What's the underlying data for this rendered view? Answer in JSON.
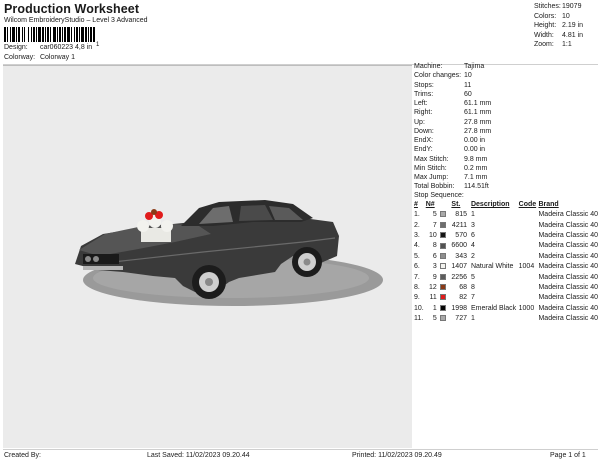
{
  "header": {
    "title": "Production Worksheet",
    "subtitle": "Wilcom EmbroideryStudio – Level 3 Advanced",
    "barcode_text": "1",
    "design_label": "Design:",
    "design_value": "car060223 4,8 in",
    "colorway_label": "Colorway:",
    "colorway_value": "Colorway 1"
  },
  "stats": [
    {
      "label": "Stitches:",
      "value": "19079"
    },
    {
      "label": "Colors:",
      "value": "10"
    },
    {
      "label": "Height:",
      "value": "2.19 in"
    },
    {
      "label": "Width:",
      "value": "4.81 in"
    },
    {
      "label": "Zoom:",
      "value": "1:1"
    }
  ],
  "parameters": [
    {
      "label": "Machine:",
      "value": "Tajima"
    },
    {
      "label": "Color changes:",
      "value": "10"
    },
    {
      "label": "Stops:",
      "value": "11"
    },
    {
      "label": "Trims:",
      "value": "60"
    },
    {
      "label": "Left:",
      "value": "61.1 mm"
    },
    {
      "label": "Right:",
      "value": "61.1 mm"
    },
    {
      "label": "Up:",
      "value": "27.8 mm"
    },
    {
      "label": "Down:",
      "value": "27.8 mm"
    },
    {
      "label": "EndX:",
      "value": "0.00 in"
    },
    {
      "label": "EndY:",
      "value": "0.00 in"
    },
    {
      "label": "Max Stitch:",
      "value": "9.8 mm"
    },
    {
      "label": "Min Stitch:",
      "value": "0.2 mm"
    },
    {
      "label": "Max Jump:",
      "value": "7.1 mm"
    },
    {
      "label": "Total Bobbin:",
      "value": "114.51ft"
    }
  ],
  "stop_sequence": {
    "title": "Stop Sequence:",
    "columns": [
      "#",
      "N#",
      "St.",
      "Description",
      "Code",
      "Brand"
    ],
    "rows": [
      {
        "idx": "1.",
        "n": "5",
        "color": "#a9a9a9",
        "st": "815",
        "desc": "1",
        "code": "",
        "brand": "Madeira Classic 40"
      },
      {
        "idx": "2.",
        "n": "7",
        "color": "#6e6e6e",
        "st": "4211",
        "desc": "3",
        "code": "",
        "brand": "Madeira Classic 40"
      },
      {
        "idx": "3.",
        "n": "10",
        "color": "#141414",
        "st": "570",
        "desc": "6",
        "code": "",
        "brand": "Madeira Classic 40"
      },
      {
        "idx": "4.",
        "n": "8",
        "color": "#525252",
        "st": "6600",
        "desc": "4",
        "code": "",
        "brand": "Madeira Classic 40"
      },
      {
        "idx": "5.",
        "n": "6",
        "color": "#8e8e8e",
        "st": "343",
        "desc": "2",
        "code": "",
        "brand": "Madeira Classic 40"
      },
      {
        "idx": "6.",
        "n": "3",
        "color": "#f2f2ee",
        "st": "1407",
        "desc": "Natural White",
        "code": "1004",
        "brand": "Madeira Classic 40"
      },
      {
        "idx": "7.",
        "n": "9",
        "color": "#5c5c5c",
        "st": "2256",
        "desc": "5",
        "code": "",
        "brand": "Madeira Classic 40"
      },
      {
        "idx": "8.",
        "n": "12",
        "color": "#8a3a17",
        "st": "68",
        "desc": "8",
        "code": "",
        "brand": "Madeira Classic 40"
      },
      {
        "idx": "9.",
        "n": "11",
        "color": "#e01b1b",
        "st": "82",
        "desc": "7",
        "code": "",
        "brand": "Madeira Classic 40"
      },
      {
        "idx": "10.",
        "n": "1",
        "color": "#050505",
        "st": "1998",
        "desc": "Emerald Black",
        "code": "1000",
        "brand": "Madeira Classic 40"
      },
      {
        "idx": "11.",
        "n": "5",
        "color": "#a9a9a9",
        "st": "727",
        "desc": "1",
        "code": "",
        "brand": "Madeira Classic 40"
      }
    ]
  },
  "footer": {
    "created": "Created By:",
    "last_saved": "Last Saved: 11/02/2023 09.20.44",
    "printed": "Printed: 11/02/2023 09.20.49",
    "page": "Page 1 of 1"
  },
  "colors": {
    "canvas_bg": "#ebebeb",
    "car_body": "#3b3b3b",
    "car_shadow": "#9c9c9c",
    "engine_white": "#f2f2ee",
    "engine_red": "#e01b1b"
  }
}
